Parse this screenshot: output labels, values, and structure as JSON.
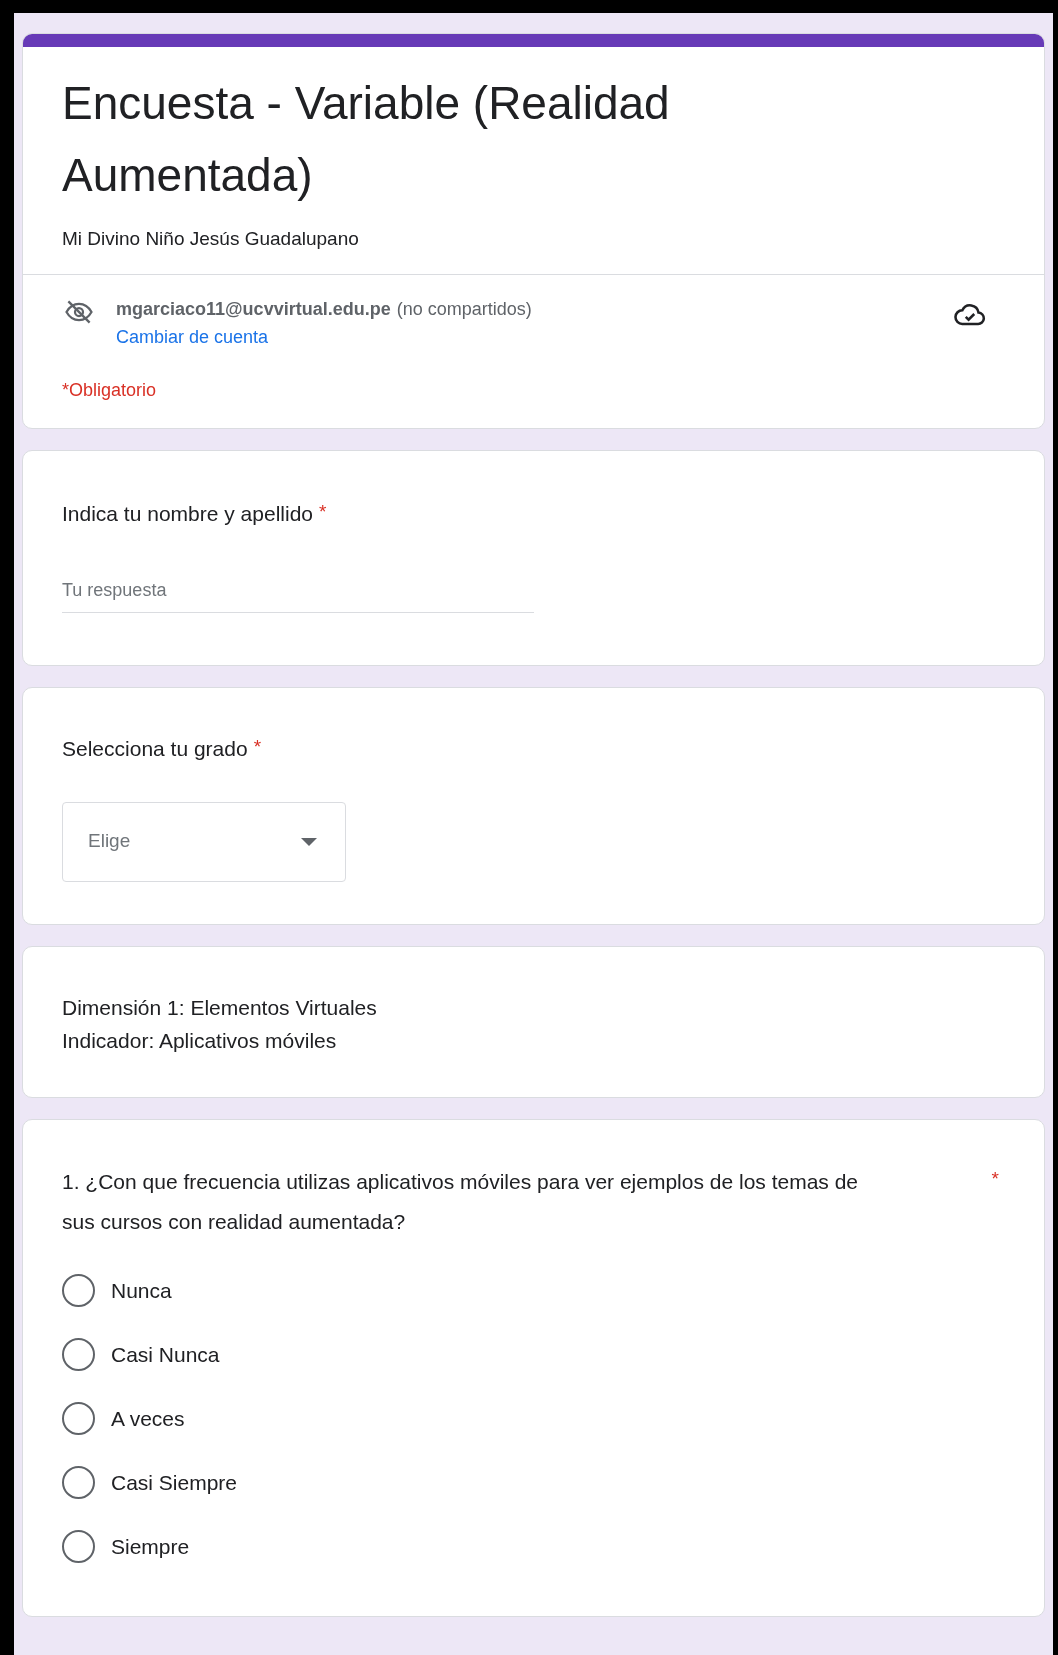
{
  "header": {
    "title": "Encuesta - Variable (Realidad Aumentada)",
    "description": "Mi Divino Niño Jesús Guadalupano",
    "account": {
      "email": "mgarciaco11@ucvvirtual.edu.pe",
      "note": "(no compartidos)",
      "switch_link": "Cambiar de cuenta"
    },
    "required_note": "*Obligatorio"
  },
  "items": [
    {
      "kind": "text",
      "label": "Indica tu nombre y apellido",
      "required_mark": "*",
      "placeholder": "Tu respuesta"
    },
    {
      "kind": "dropdown",
      "label": "Selecciona tu grado",
      "required_mark": "*",
      "placeholder": "Elige"
    },
    {
      "kind": "section",
      "lines": [
        "Dimensión 1: Elementos Virtuales",
        "Indicador: Aplicativos móviles"
      ]
    },
    {
      "kind": "radio",
      "label": "1. ¿Con que frecuencia utilizas aplicativos móviles para ver ejemplos de los temas de sus cursos con realidad aumentada?",
      "required_mark": "*",
      "options": [
        {
          "label": "Nunca",
          "selected": false
        },
        {
          "label": "Casi Nunca",
          "selected": false
        },
        {
          "label": "A veces",
          "selected": false
        },
        {
          "label": "Casi Siempre",
          "selected": false
        },
        {
          "label": "Siempre",
          "selected": false
        }
      ]
    }
  ]
}
